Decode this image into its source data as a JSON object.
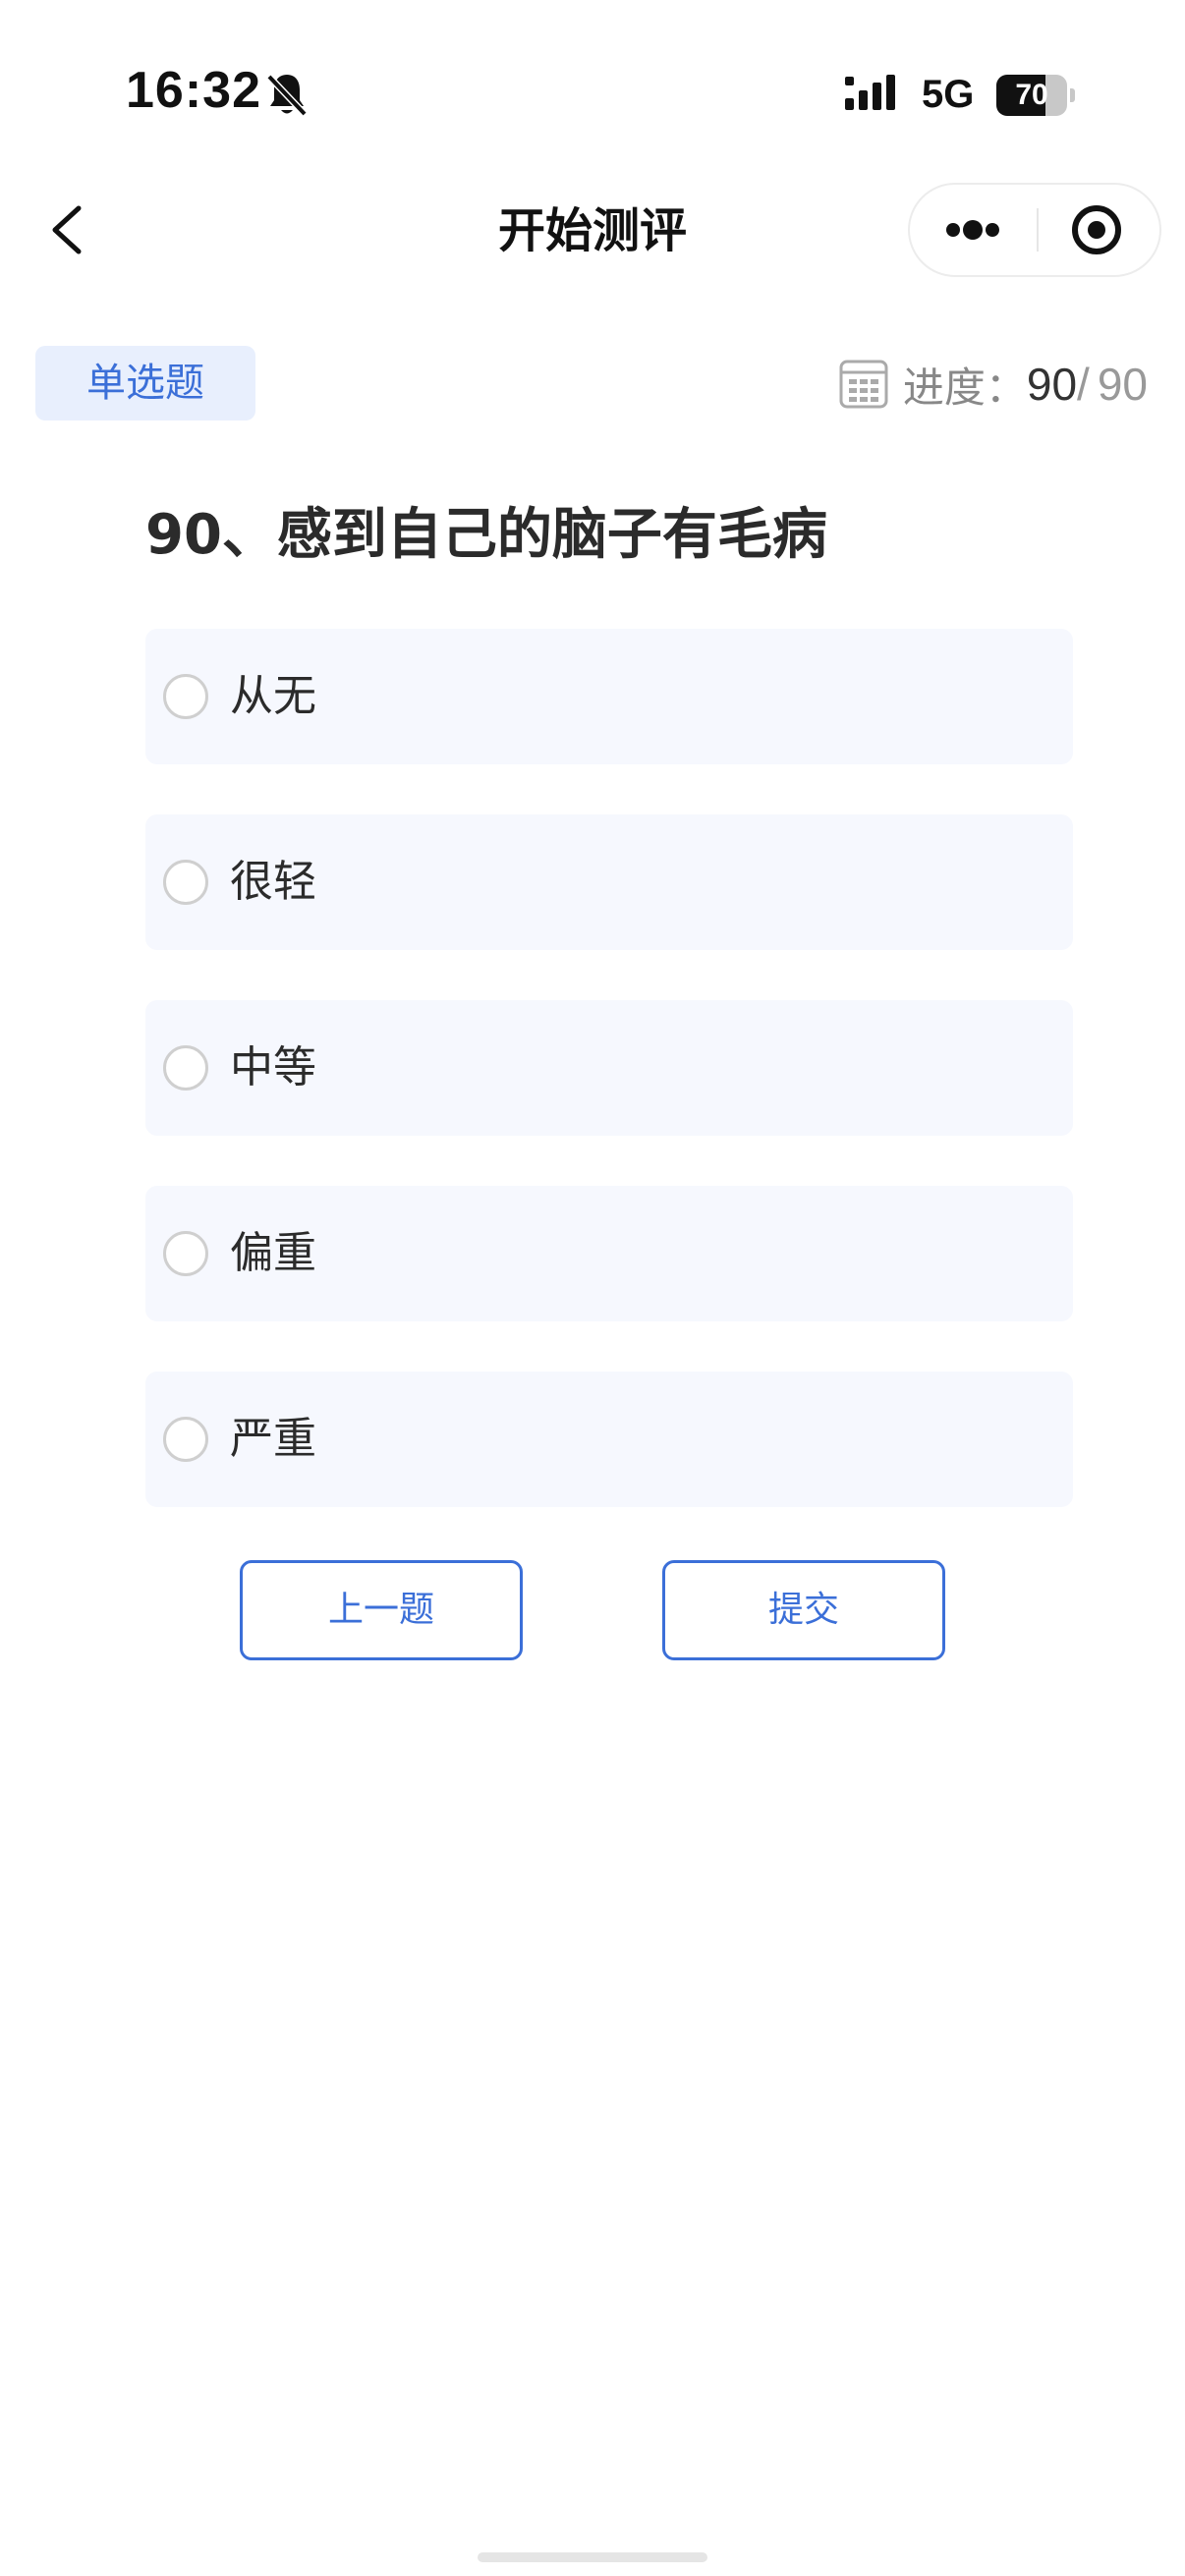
{
  "status_bar": {
    "time": "16:32",
    "silent_icon": "bell-slash-icon",
    "signal_icon": "cellular-signal-icon",
    "network": "5G",
    "battery_percent": "70",
    "battery_level": 0.7
  },
  "nav": {
    "back_icon": "chevron-left-icon",
    "title": "开始测评",
    "more_icon": "more-dots-icon",
    "close_icon": "target-circle-icon"
  },
  "question_header": {
    "type_label": "单选题",
    "progress_icon": "grid-calendar-icon",
    "progress_label": "进度：",
    "progress_current": "90",
    "progress_separator": "/",
    "progress_total": "90"
  },
  "question": {
    "text": "90、感到自己的脑子有毛病"
  },
  "options": [
    {
      "label": "从无",
      "selected": false
    },
    {
      "label": "很轻",
      "selected": false
    },
    {
      "label": "中等",
      "selected": false
    },
    {
      "label": "偏重",
      "selected": false
    },
    {
      "label": "严重",
      "selected": false
    }
  ],
  "actions": {
    "prev_label": "上一题",
    "submit_label": "提交"
  },
  "colors": {
    "accent": "#3b6fd8",
    "tag_bg": "#e8effd",
    "option_bg": "#f6f8fe"
  }
}
